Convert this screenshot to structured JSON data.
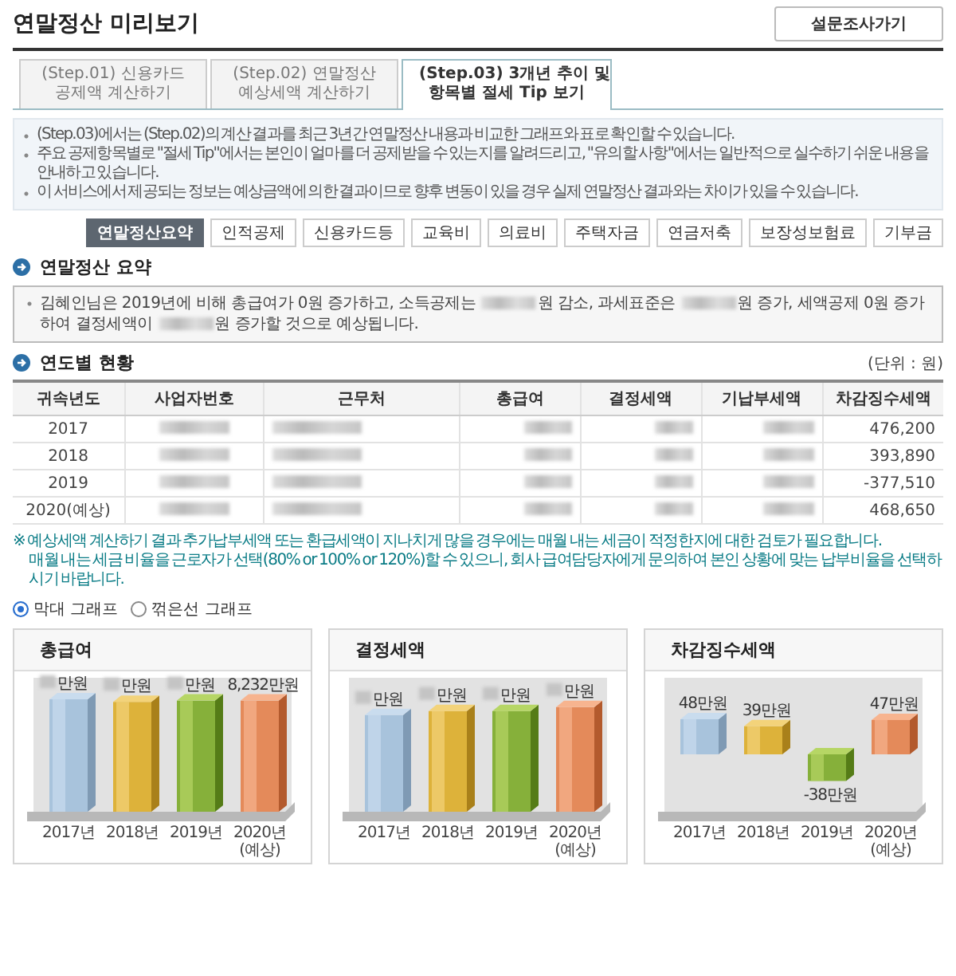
{
  "page": {
    "title": "연말정산 미리보기",
    "survey_button": "설문조사가기"
  },
  "tabs": [
    {
      "lines": [
        "(Step.01) 신용카드",
        "공제액 계산하기"
      ],
      "selected": false
    },
    {
      "lines": [
        "(Step.02) 연말정산",
        "예상세액 계산하기"
      ],
      "selected": false
    },
    {
      "lines": [
        "(Step.03) 3개년 추이 및",
        "항목별 절세 Tip 보기"
      ],
      "selected": true
    }
  ],
  "info": [
    "(Step.03)에서는 (Step.02)의 계산 결과를 최근 3년간 연말정산 내용과 비교한 그래프와 표로 확인할 수 있습니다.",
    "주요 공제항목별로 \"절세 Tip\"에서는 본인이 얼마를 더 공제받을 수 있는지를 알려드리고, \"유의할 사항\"에서는 일반적으로 실수하기 쉬운 내용을 안내하고 있습니다.",
    "이 서비스에서 제공되는 정보는 예상금액에 의한 결과이므로 향후 변동이 있을 경우 실제 연말정산 결과와는 차이가 있을 수 있습니다."
  ],
  "filters": [
    {
      "label": "연말정산요약",
      "selected": true
    },
    {
      "label": "인적공제",
      "selected": false
    },
    {
      "label": "신용카드등",
      "selected": false
    },
    {
      "label": "교육비",
      "selected": false
    },
    {
      "label": "의료비",
      "selected": false
    },
    {
      "label": "주택자금",
      "selected": false
    },
    {
      "label": "연금저축",
      "selected": false
    },
    {
      "label": "보장성보험료",
      "selected": false
    },
    {
      "label": "기부금",
      "selected": false
    }
  ],
  "summary": {
    "heading": "연말정산 요약",
    "segments": [
      "김혜인님은 2019년에 비해 총급여가 0원 증가하고, 소득공제는 ",
      "원 감소, 과세표준은 ",
      "원 증가, 세액공제 0원 증가하여 결정세액이 ",
      "원 증가할 것으로 예상됩니다."
    ]
  },
  "yearly": {
    "heading": "연도별 현황",
    "unit": "(단위 : 원)",
    "columns": [
      "귀속년도",
      "사업자번호",
      "근무처",
      "총급여",
      "결정세액",
      "기납부세액",
      "차감징수세액"
    ],
    "rows": [
      {
        "year": "2017",
        "difference": "476,200"
      },
      {
        "year": "2018",
        "difference": "393,890"
      },
      {
        "year": "2019",
        "difference": "-377,510"
      },
      {
        "year": "2020(예상)",
        "difference": "468,650"
      }
    ]
  },
  "notes": [
    "※ 예상세액 계산하기 결과 추가납부세액 또는 환급세액이 지나치게 많을 경우에는 매월 내는 세금이 적정한지에 대한 검토가 필요합니다.",
    "매월 내는 세금 비율을 근로자가 선택(80% or 100% or 120%)할 수 있으니, 회사 급여담당자에게 문의하여 본인 상황에 맞는 납부비율을 선택하시기 바랍니다."
  ],
  "chart_types": [
    {
      "label": "막대 그래프",
      "selected": true
    },
    {
      "label": "꺾은선 그래프",
      "selected": false
    }
  ],
  "charts": [
    {
      "title": "총급여",
      "bar_labels": [
        {
          "text": "만원",
          "masked": true
        },
        {
          "text": "만원",
          "masked": true
        },
        {
          "text": "만원",
          "masked": true
        },
        {
          "text": "8,232만원",
          "masked": false
        }
      ],
      "categories": [
        [
          "2017년"
        ],
        [
          "2018년"
        ],
        [
          "2019년"
        ],
        [
          "2020년",
          "(예상)"
        ]
      ]
    },
    {
      "title": "결정세액",
      "bar_labels": [
        {
          "text": "만원",
          "masked": true
        },
        {
          "text": "만원",
          "masked": true
        },
        {
          "text": "만원",
          "masked": true
        },
        {
          "text": "만원",
          "masked": true
        }
      ],
      "categories": [
        [
          "2017년"
        ],
        [
          "2018년"
        ],
        [
          "2019년"
        ],
        [
          "2020년",
          "(예상)"
        ]
      ]
    },
    {
      "title": "차감징수세액",
      "bar_labels": [
        {
          "text": "48만원",
          "masked": false
        },
        {
          "text": "39만원",
          "masked": false
        },
        {
          "text": "-38만원",
          "masked": false
        },
        {
          "text": "47만원",
          "masked": false
        }
      ],
      "categories": [
        [
          "2017년"
        ],
        [
          "2018년"
        ],
        [
          "2019년"
        ],
        [
          "2020년",
          "(예상)"
        ]
      ]
    }
  ]
}
